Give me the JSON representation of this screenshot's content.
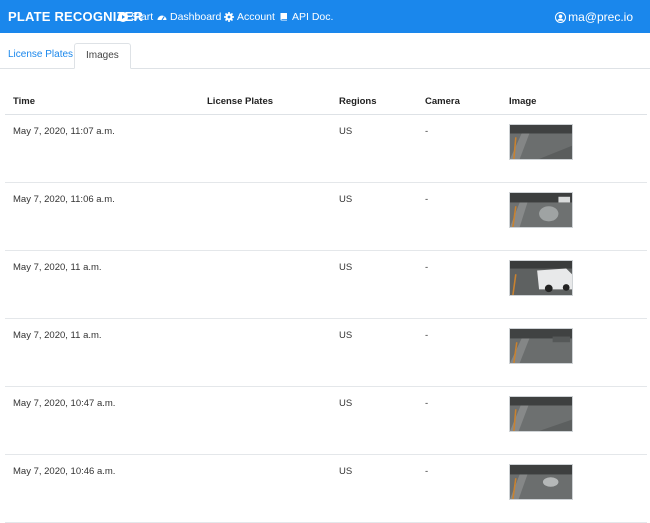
{
  "header": {
    "brand": "PLATE RECOGNIZER",
    "nav": [
      {
        "label": "Start",
        "icon": "play-circle-icon"
      },
      {
        "label": "Dashboard",
        "icon": "dashboard-icon"
      },
      {
        "label": "Account",
        "icon": "gear-icon"
      },
      {
        "label": "API Doc.",
        "icon": "book-icon"
      }
    ],
    "user": "ma@prec.io",
    "color": "#1a87ec"
  },
  "tabs": [
    {
      "label": "License Plates",
      "active": false
    },
    {
      "label": "Images",
      "active": true
    }
  ],
  "table": {
    "columns": [
      "Time",
      "License Plates",
      "Regions",
      "Camera",
      "Image"
    ],
    "rows": [
      {
        "time": "May 7, 2020, 11:07 a.m.",
        "plates": "",
        "region": "US",
        "camera": "-"
      },
      {
        "time": "May 7, 2020, 11:06 a.m.",
        "plates": "",
        "region": "US",
        "camera": "-"
      },
      {
        "time": "May 7, 2020, 11 a.m.",
        "plates": "",
        "region": "US",
        "camera": "-"
      },
      {
        "time": "May 7, 2020, 11 a.m.",
        "plates": "",
        "region": "US",
        "camera": "-"
      },
      {
        "time": "May 7, 2020, 10:47 a.m.",
        "plates": "",
        "region": "US",
        "camera": "-"
      },
      {
        "time": "May 7, 2020, 10:46 a.m.",
        "plates": "",
        "region": "US",
        "camera": "-"
      }
    ]
  }
}
